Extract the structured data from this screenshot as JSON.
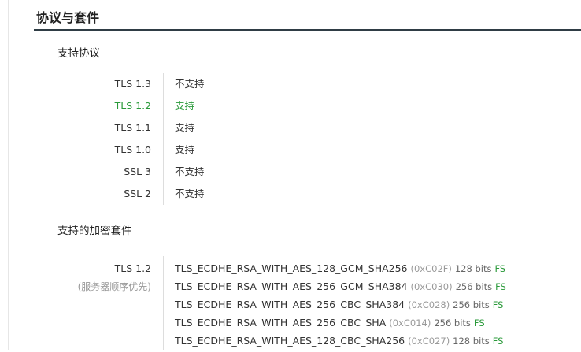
{
  "section": {
    "title": "协议与套件"
  },
  "protocols": {
    "heading": "支持协议",
    "rows": [
      {
        "name": "TLS 1.3",
        "status": "不支持"
      },
      {
        "name": "TLS 1.2",
        "status": "支持"
      },
      {
        "name": "TLS 1.1",
        "status": "支持"
      },
      {
        "name": "TLS 1.0",
        "status": "支持"
      },
      {
        "name": "SSL 3",
        "status": "不支持"
      },
      {
        "name": "SSL 2",
        "status": "不支持"
      }
    ],
    "highlight_color": "#2a9a3a"
  },
  "cipher_suites": {
    "heading": "支持的加密套件",
    "version": "TLS 1.2",
    "order_note": "(服务器顺序优先)",
    "suites": [
      {
        "name": "TLS_ECDHE_RSA_WITH_AES_128_GCM_SHA256",
        "hex": "(0xC02F)",
        "bits": "128 bits",
        "fs": "FS"
      },
      {
        "name": "TLS_ECDHE_RSA_WITH_AES_256_GCM_SHA384",
        "hex": "(0xC030)",
        "bits": "256 bits",
        "fs": "FS"
      },
      {
        "name": "TLS_ECDHE_RSA_WITH_AES_256_CBC_SHA384",
        "hex": "(0xC028)",
        "bits": "256 bits",
        "fs": "FS"
      },
      {
        "name": "TLS_ECDHE_RSA_WITH_AES_256_CBC_SHA",
        "hex": "(0xC014)",
        "bits": "256 bits",
        "fs": "FS"
      },
      {
        "name": "TLS_ECDHE_RSA_WITH_AES_128_CBC_SHA256",
        "hex": "(0xC027)",
        "bits": "128 bits",
        "fs": "FS"
      }
    ]
  }
}
